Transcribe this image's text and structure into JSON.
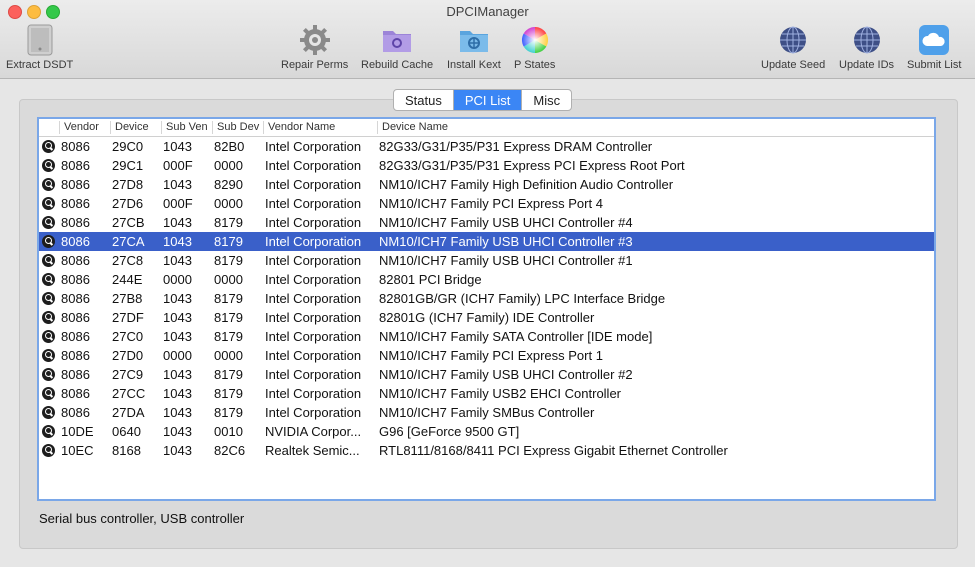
{
  "window": {
    "title": "DPCIManager"
  },
  "toolbar": {
    "items": [
      {
        "label": "Extract DSDT",
        "icon": "mac-pro-tower-icon"
      },
      {
        "label": "Repair Perms",
        "icon": "gear-icon"
      },
      {
        "label": "Rebuild Cache",
        "icon": "purple-folder-icon"
      },
      {
        "label": "Install Kext",
        "icon": "blue-folder-icon"
      },
      {
        "label": "P States",
        "icon": "color-wheel-icon"
      },
      {
        "label": "Update Seed",
        "icon": "globe-icon"
      },
      {
        "label": "Update IDs",
        "icon": "globe-icon"
      },
      {
        "label": "Submit List",
        "icon": "cloud-icon"
      }
    ]
  },
  "tabs": [
    "Status",
    "PCI List",
    "Misc"
  ],
  "selected_tab": "PCI List",
  "table": {
    "columns": [
      "Vendor",
      "Device",
      "Sub Ven",
      "Sub Dev",
      "Vendor Name",
      "Device Name"
    ],
    "rows": [
      [
        "8086",
        "29C0",
        "1043",
        "82B0",
        "Intel Corporation",
        "82G33/G31/P35/P31 Express DRAM Controller"
      ],
      [
        "8086",
        "29C1",
        "000F",
        "0000",
        "Intel Corporation",
        "82G33/G31/P35/P31 Express PCI Express Root Port"
      ],
      [
        "8086",
        "27D8",
        "1043",
        "8290",
        "Intel Corporation",
        "NM10/ICH7 Family High Definition Audio Controller"
      ],
      [
        "8086",
        "27D6",
        "000F",
        "0000",
        "Intel Corporation",
        "NM10/ICH7 Family PCI Express Port 4"
      ],
      [
        "8086",
        "27CB",
        "1043",
        "8179",
        "Intel Corporation",
        "NM10/ICH7 Family USB UHCI Controller #4"
      ],
      [
        "8086",
        "27CA",
        "1043",
        "8179",
        "Intel Corporation",
        "NM10/ICH7 Family USB UHCI Controller #3"
      ],
      [
        "8086",
        "27C8",
        "1043",
        "8179",
        "Intel Corporation",
        "NM10/ICH7 Family USB UHCI Controller #1"
      ],
      [
        "8086",
        "244E",
        "0000",
        "0000",
        "Intel Corporation",
        "82801 PCI Bridge"
      ],
      [
        "8086",
        "27B8",
        "1043",
        "8179",
        "Intel Corporation",
        "82801GB/GR (ICH7 Family) LPC Interface Bridge"
      ],
      [
        "8086",
        "27DF",
        "1043",
        "8179",
        "Intel Corporation",
        "82801G (ICH7 Family) IDE Controller"
      ],
      [
        "8086",
        "27C0",
        "1043",
        "8179",
        "Intel Corporation",
        "NM10/ICH7 Family SATA Controller [IDE mode]"
      ],
      [
        "8086",
        "27D0",
        "0000",
        "0000",
        "Intel Corporation",
        "NM10/ICH7 Family PCI Express Port 1"
      ],
      [
        "8086",
        "27C9",
        "1043",
        "8179",
        "Intel Corporation",
        "NM10/ICH7 Family USB UHCI Controller #2"
      ],
      [
        "8086",
        "27CC",
        "1043",
        "8179",
        "Intel Corporation",
        "NM10/ICH7 Family USB2 EHCI Controller"
      ],
      [
        "8086",
        "27DA",
        "1043",
        "8179",
        "Intel Corporation",
        "NM10/ICH7 Family SMBus Controller"
      ],
      [
        "10DE",
        "0640",
        "1043",
        "0010",
        "NVIDIA Corpor...",
        "G96 [GeForce 9500 GT]"
      ],
      [
        "10EC",
        "8168",
        "1043",
        "82C6",
        "Realtek Semic...",
        "RTL8111/8168/8411 PCI Express Gigabit Ethernet Controller"
      ]
    ],
    "selected_row": 5
  },
  "status_text": "Serial bus controller, USB controller",
  "colors": {
    "selection": "#3a60c9",
    "tab_selected": "#3b86f5",
    "focus_ring": "#7aa7e8"
  }
}
